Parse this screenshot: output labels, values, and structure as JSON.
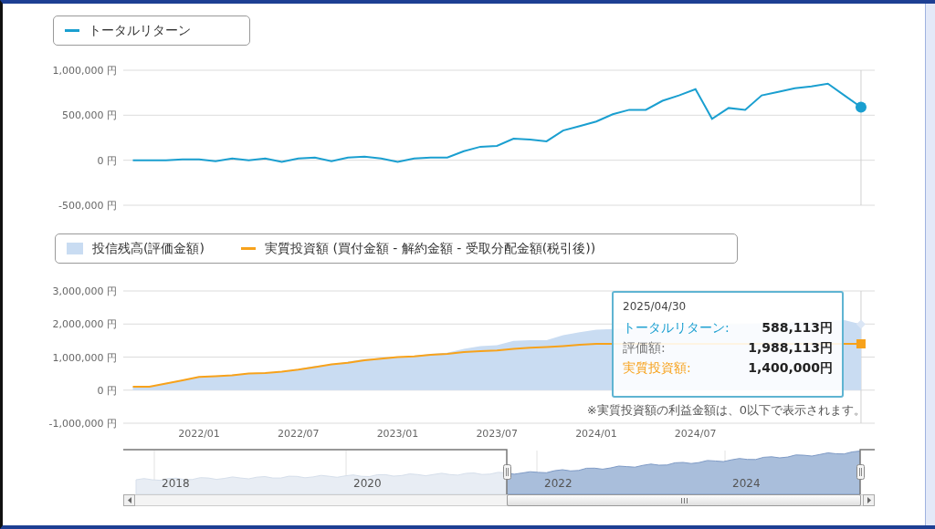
{
  "return_chart": {
    "chart_data": {
      "type": "line",
      "grid": true,
      "categories": [
        null,
        null,
        null,
        null,
        null,
        null,
        null,
        null,
        null,
        null,
        null,
        null,
        null,
        null,
        null,
        null,
        null,
        null,
        null,
        null,
        null,
        null,
        null,
        null,
        null,
        null,
        null,
        null,
        null,
        null,
        null,
        null,
        null,
        null,
        null,
        null,
        null,
        null,
        null,
        null,
        null,
        null,
        null,
        null,
        null
      ],
      "ylim": [
        -500000,
        1000000
      ],
      "yticks": [
        {
          "value": 1000000,
          "label": "1,000,000 円"
        },
        {
          "value": 500000,
          "label": "500,000 円"
        },
        {
          "value": 0,
          "label": "0 円"
        },
        {
          "value": -500000,
          "label": "-500,000 円"
        }
      ],
      "series": [
        {
          "name": "トータルリターン",
          "color": "#1a9fd0",
          "values": [
            0,
            0,
            0,
            10000,
            10000,
            -10000,
            20000,
            0,
            20000,
            -20000,
            20000,
            30000,
            -10000,
            30000,
            40000,
            20000,
            -20000,
            20000,
            30000,
            30000,
            100000,
            150000,
            160000,
            240000,
            230000,
            210000,
            330000,
            380000,
            430000,
            510000,
            560000,
            560000,
            660000,
            720000,
            790000,
            460000,
            580000,
            560000,
            720000,
            760000,
            800000,
            820000,
            850000,
            720000,
            590000
          ]
        }
      ]
    }
  },
  "balance_chart": {
    "chart_data": {
      "type": "area",
      "grid": true,
      "categories": [
        null,
        null,
        null,
        null,
        "2022/01",
        null,
        null,
        null,
        null,
        null,
        "2022/07",
        null,
        null,
        null,
        null,
        null,
        "2023/01",
        null,
        null,
        null,
        null,
        null,
        "2023/07",
        null,
        null,
        null,
        null,
        null,
        "2024/01",
        null,
        null,
        null,
        null,
        null,
        "2024/07",
        null,
        null,
        null,
        null,
        null,
        null,
        null,
        null,
        null,
        null
      ],
      "ylim": [
        -1000000,
        3000000
      ],
      "yticks": [
        {
          "value": 3000000,
          "label": "3,000,000 円"
        },
        {
          "value": 2000000,
          "label": "2,000,000 円"
        },
        {
          "value": 1000000,
          "label": "1,000,000 円"
        },
        {
          "value": 0,
          "label": "0 円"
        },
        {
          "value": -1000000,
          "label": "-1,000,000 円"
        }
      ],
      "series": [
        {
          "name": "投信残高(評価金額)",
          "type": "area",
          "color": "#c9dcf2",
          "values": [
            100000,
            100000,
            210000,
            310000,
            410000,
            410000,
            470000,
            500000,
            540000,
            550000,
            640000,
            730000,
            770000,
            860000,
            940000,
            970000,
            990000,
            1040000,
            1100000,
            1130000,
            1250000,
            1330000,
            1360000,
            1490000,
            1510000,
            1510000,
            1660000,
            1750000,
            1830000,
            null,
            null,
            null,
            null,
            null,
            null,
            null,
            null,
            null,
            null,
            null,
            null,
            null,
            null,
            2120000,
            1990000
          ]
        },
        {
          "name": "実質投資額 (買付金額 - 解約金額 - 受取分配金額(税引後))",
          "type": "line",
          "color": "#f7a21b",
          "values": [
            100000,
            100000,
            200000,
            300000,
            400000,
            420000,
            450000,
            500000,
            520000,
            560000,
            620000,
            700000,
            780000,
            830000,
            900000,
            950000,
            1000000,
            1020000,
            1070000,
            1100000,
            1150000,
            1180000,
            1200000,
            1250000,
            1280000,
            1300000,
            1330000,
            1370000,
            1400000,
            null,
            null,
            null,
            null,
            null,
            null,
            null,
            null,
            null,
            null,
            null,
            null,
            null,
            null,
            1400000,
            1400000
          ]
        }
      ],
      "annotations": [
        "※実質投資額の利益金額は、0以下で表示されます。"
      ]
    },
    "tooltip": {
      "date": "2025/04/30",
      "rows": [
        {
          "label": "トータルリターン:",
          "value": "588,113円",
          "color": "#1a9fd0"
        },
        {
          "label": "評価額:",
          "value": "1,988,113円",
          "color": "#777777"
        },
        {
          "label": "実質投資額:",
          "value": "1,400,000円",
          "color": "#f7a21b"
        }
      ]
    }
  },
  "navigator": {
    "labels": [
      "2018",
      "2020",
      "2022",
      "2024"
    ]
  }
}
